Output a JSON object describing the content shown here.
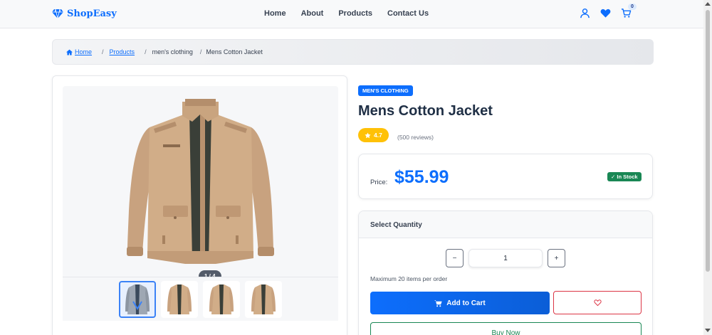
{
  "nav": {
    "brand": "ShopEasy",
    "links": [
      "Home",
      "About",
      "Products",
      "Contact Us"
    ],
    "cart_count": "0"
  },
  "breadcrumb": {
    "home": "Home",
    "products": "Products",
    "category": "men's clothing",
    "current": "Mens Cotton Jacket",
    "separator": "/"
  },
  "gallery": {
    "counter": "1 / 4"
  },
  "product": {
    "category": "MEN'S CLOTHING",
    "title": "Mens Cotton Jacket",
    "rating": "4.7",
    "reviews": "(500 reviews)",
    "price_label": "Price:",
    "price": "$55.99",
    "stock": "✓ In Stock"
  },
  "quantity": {
    "header": "Select Quantity",
    "minus": "−",
    "plus": "+",
    "value": "1",
    "note": "Maximum 20 items per order"
  },
  "actions": {
    "add_to_cart": "Add to Cart",
    "buy_now": "Buy Now"
  },
  "colors": {
    "primary": "#0d6efd",
    "rating": "#ffc107",
    "stock": "#198754",
    "danger": "#dc3545"
  }
}
